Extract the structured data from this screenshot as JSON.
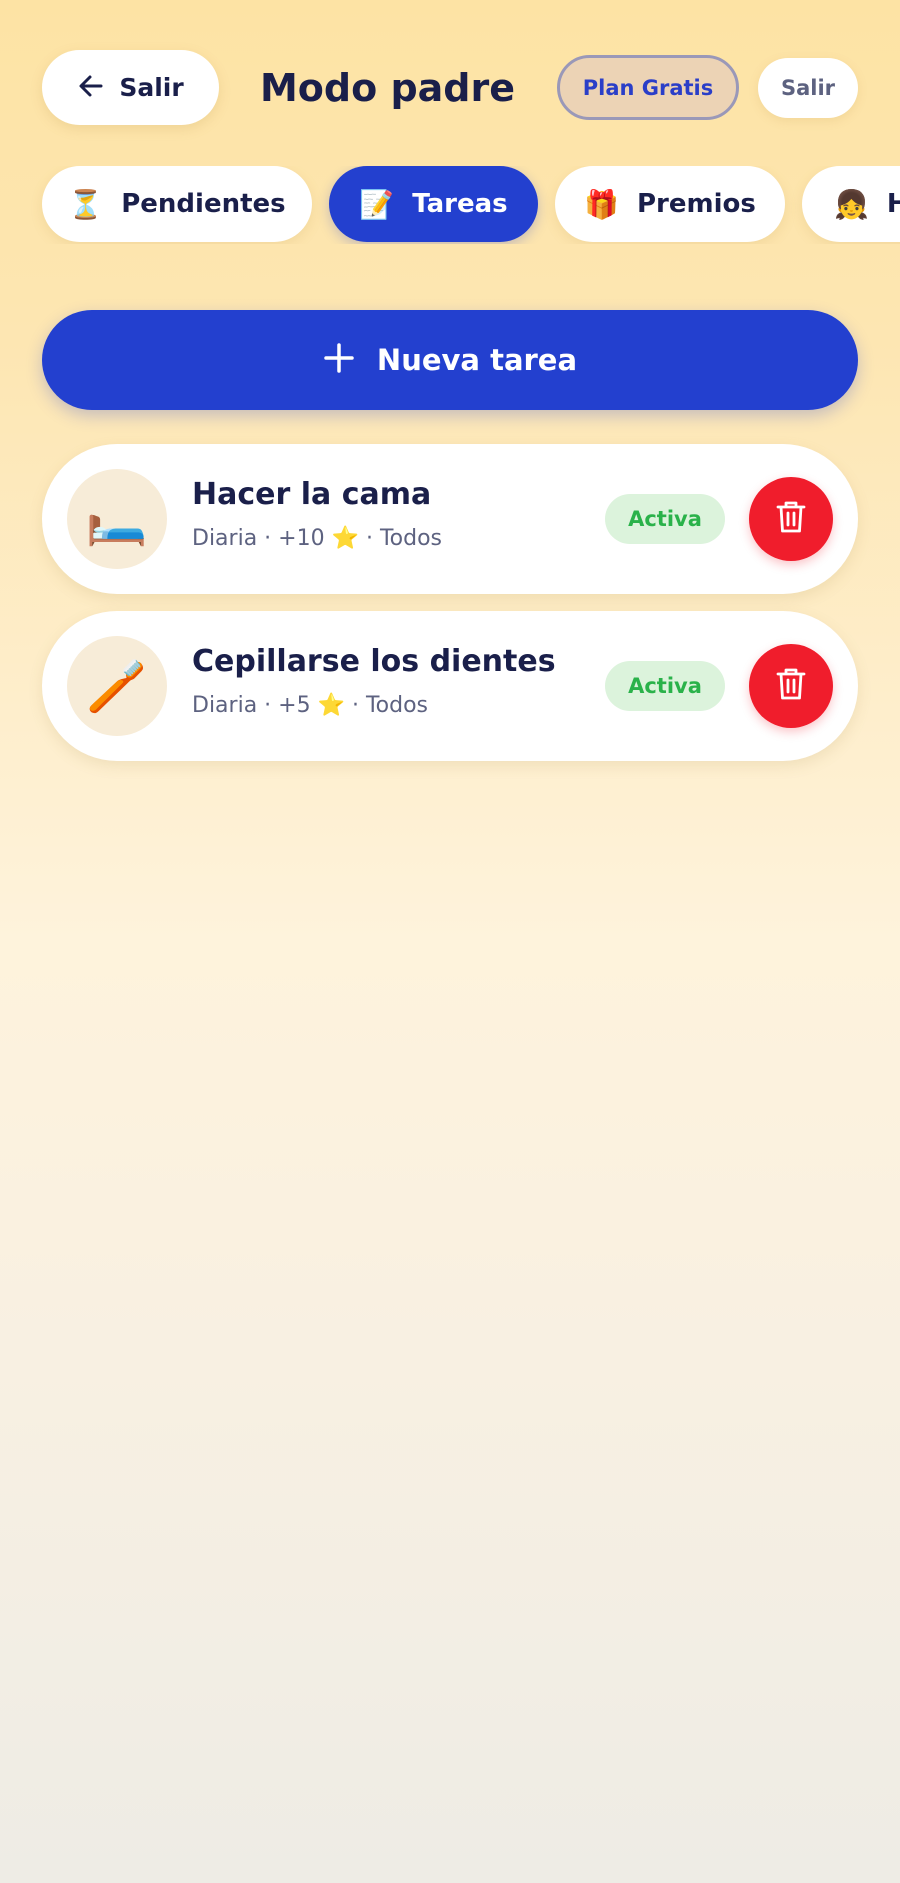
{
  "header": {
    "back_label": "Salir",
    "back_icon": "arrow-left-icon",
    "title": "Modo padre",
    "plan_label": "Plan Gratis",
    "exit_label": "Salir"
  },
  "tabs": [
    {
      "label": "Pendientes",
      "emoji": "⏳",
      "icon": "hourglass-icon",
      "active": false
    },
    {
      "label": "Tareas",
      "emoji": "📝",
      "icon": "memo-icon",
      "active": true
    },
    {
      "label": "Premios",
      "emoji": "🎁",
      "icon": "gift-icon",
      "active": false
    },
    {
      "label": "H",
      "emoji": "👧",
      "icon": "girl-icon",
      "active": false
    }
  ],
  "new_task": {
    "label": "Nueva tarea",
    "icon": "plus-icon"
  },
  "tasks": [
    {
      "emoji": "🛏️",
      "icon": "bed-icon",
      "name": "Hacer la cama",
      "meta": "Diaria · +10 ⭐ · Todos",
      "status": "Activa"
    },
    {
      "emoji": "🪥",
      "icon": "toothbrush-icon",
      "name": "Cepillarse los dientes",
      "meta": "Diaria · +5 ⭐ · Todos",
      "status": "Activa"
    }
  ],
  "colors": {
    "accent": "#2340cf",
    "danger": "#f01d2c",
    "success": "#2ab24a",
    "text_dark": "#1a1f4a"
  }
}
